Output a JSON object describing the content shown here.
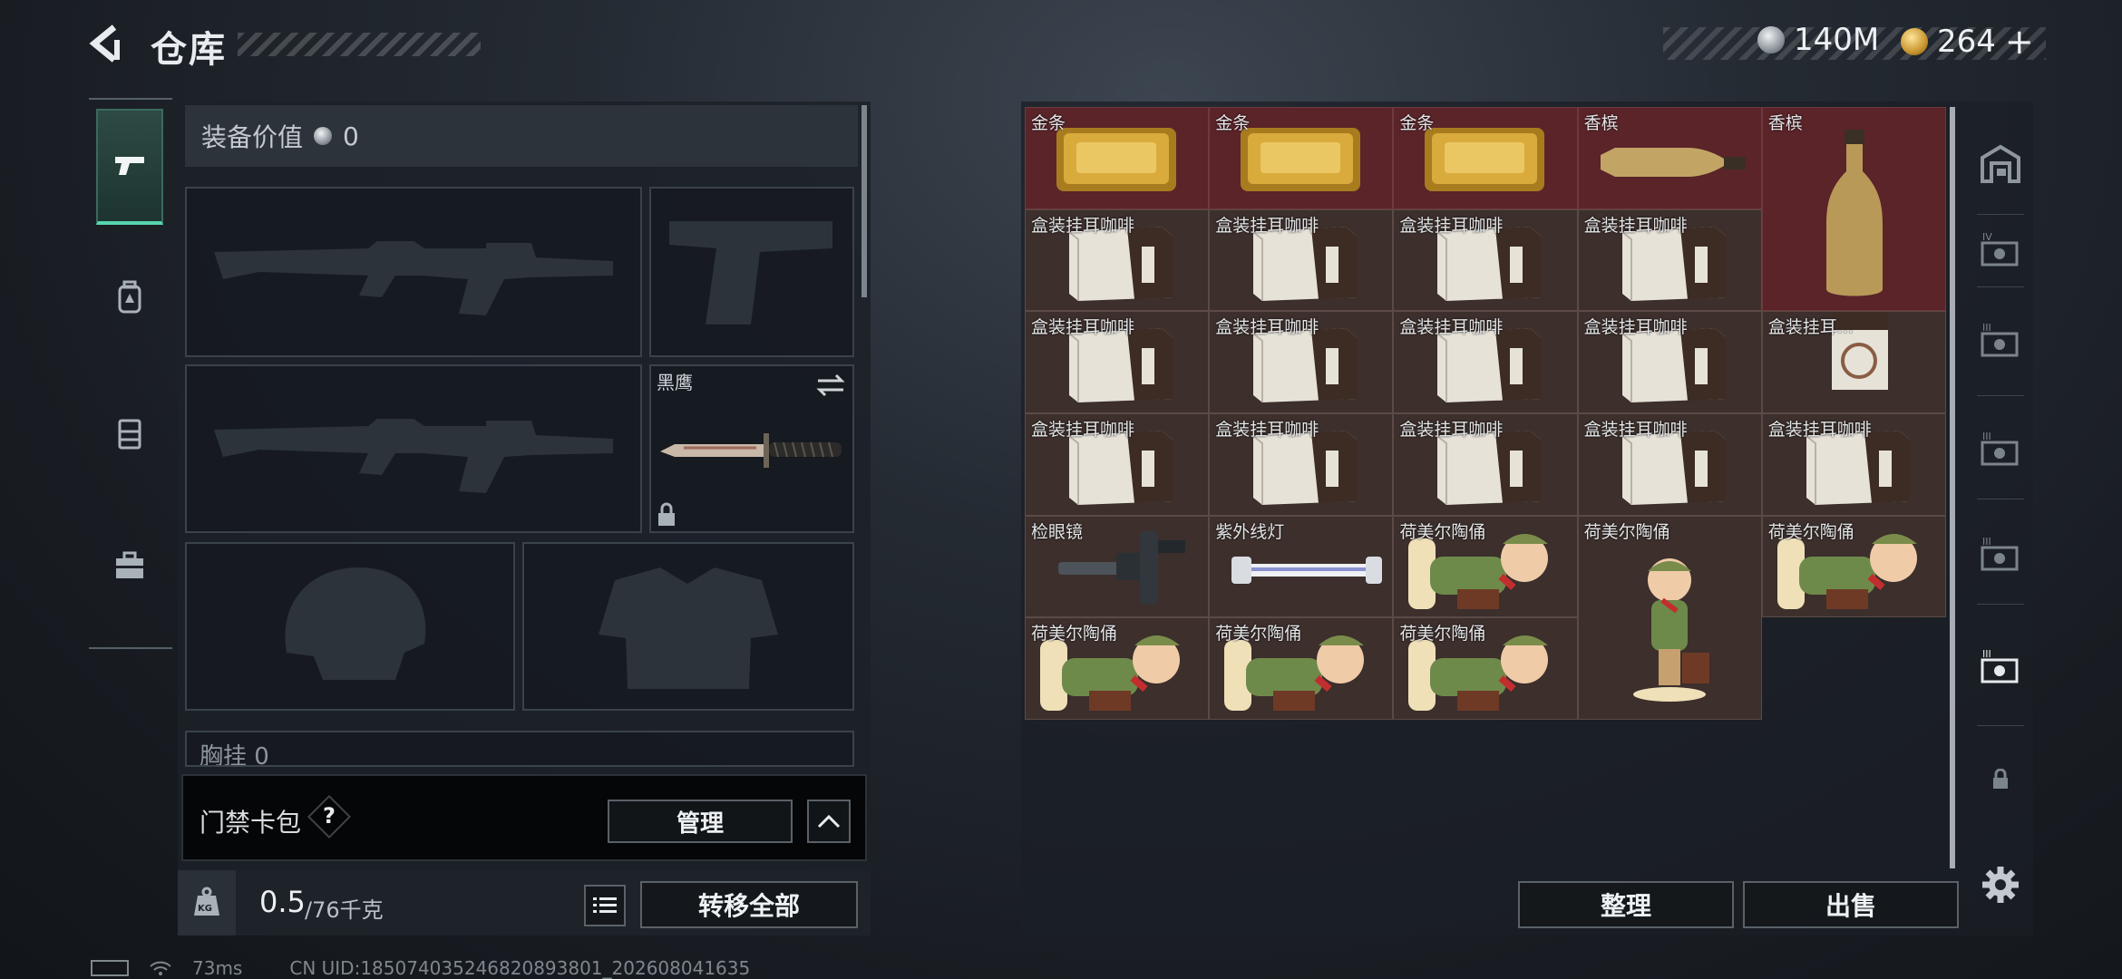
{
  "header": {
    "title": "仓库",
    "currency_silver": "140M",
    "currency_gold": "264",
    "add_symbol": "+"
  },
  "equipment": {
    "value_label": "装备价值",
    "value_amount": "0",
    "knife_label": "黑鹰",
    "chest_rig_label": "胸挂",
    "chest_rig_count": "0",
    "keycard_label": "门禁卡包",
    "help_symbol": "?",
    "manage_button": "管理",
    "weight_current": "0.5",
    "weight_max": "/76千克",
    "weight_icon_text": "KG",
    "transfer_all_button": "转移全部"
  },
  "stash": {
    "items": [
      {
        "label": "金条",
        "type": "gold",
        "red": true
      },
      {
        "label": "金条",
        "type": "gold",
        "red": true
      },
      {
        "label": "金条",
        "type": "gold",
        "red": true
      },
      {
        "label": "香槟",
        "type": "champagne-flat",
        "red": true
      },
      {
        "label": "香槟",
        "type": "champagne-tall",
        "red": true,
        "tall": true
      },
      {
        "label": "盒装挂耳咖啡",
        "type": "coffee"
      },
      {
        "label": "盒装挂耳咖啡",
        "type": "coffee"
      },
      {
        "label": "盒装挂耳咖啡",
        "type": "coffee"
      },
      {
        "label": "盒装挂耳咖啡",
        "type": "coffee"
      },
      {
        "label": "盒装挂耳咖啡",
        "type": "coffee"
      },
      {
        "label": "盒装挂耳咖啡",
        "type": "coffee"
      },
      {
        "label": "盒装挂耳咖啡",
        "type": "coffee"
      },
      {
        "label": "盒装挂耳咖啡",
        "type": "coffee"
      },
      {
        "label": "盒装挂耳...",
        "type": "coffee-upright"
      },
      {
        "label": "盒装挂耳咖啡",
        "type": "coffee"
      },
      {
        "label": "盒装挂耳咖啡",
        "type": "coffee"
      },
      {
        "label": "盒装挂耳咖啡",
        "type": "coffee"
      },
      {
        "label": "盒装挂耳咖啡",
        "type": "coffee"
      },
      {
        "label": "盒装挂耳咖啡",
        "type": "coffee"
      },
      {
        "label": "检眼镜",
        "type": "scope"
      },
      {
        "label": "紫外线灯",
        "type": "uvlamp"
      },
      {
        "label": "荷美尔陶俑",
        "type": "figurine"
      },
      {
        "label": "荷美尔陶俑",
        "type": "figurine-tall",
        "tall": true
      },
      {
        "label": "荷美尔陶俑",
        "type": "figurine"
      },
      {
        "label": "荷美尔陶俑",
        "type": "figurine"
      },
      {
        "label": "荷美尔陶俑",
        "type": "figurine"
      },
      {
        "label": "荷美尔陶俑",
        "type": "figurine"
      }
    ],
    "sort_button": "整理",
    "sell_button": "出售",
    "container_levels": [
      "IV",
      "III",
      "III",
      "III",
      "III"
    ]
  },
  "status_bar": {
    "ping": "73ms",
    "uid": "CN UID:185074035246820893801_202608041635"
  }
}
